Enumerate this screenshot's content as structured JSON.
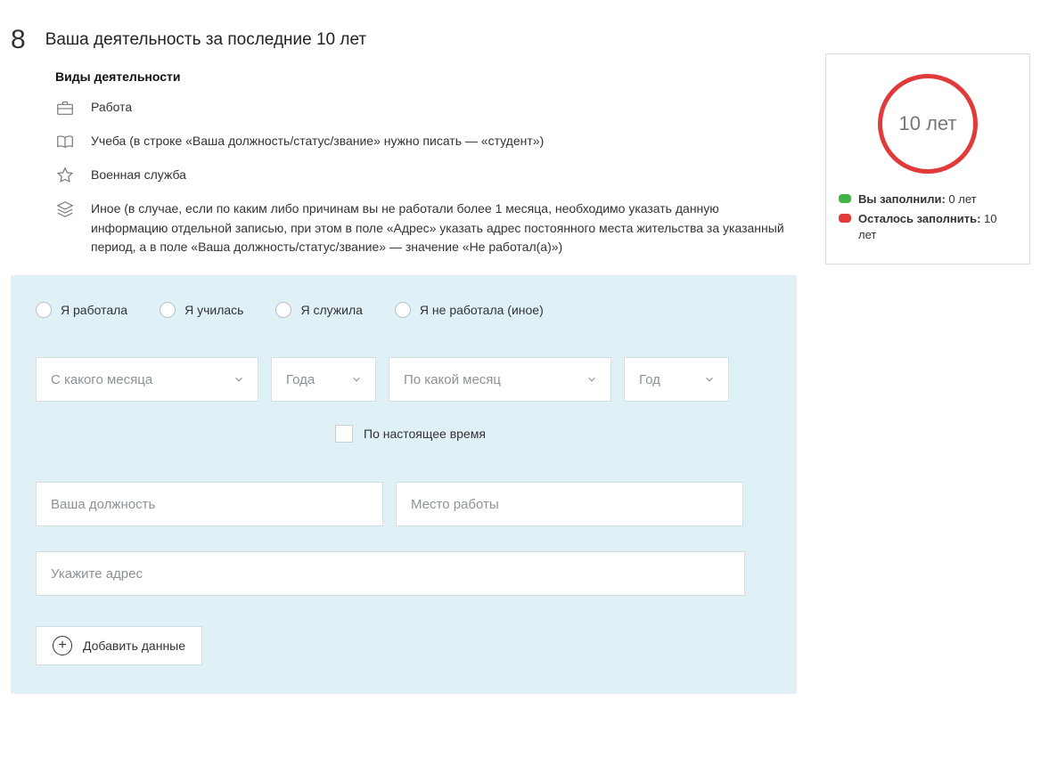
{
  "step_number": "8",
  "step_title": "Ваша деятельность за последние 10 лет",
  "subtitle": "Виды деятельности",
  "activities": [
    {
      "label": "Работа"
    },
    {
      "label": "Учеба (в строке «Ваша должность/статус/звание» нужно писать — «студент»)"
    },
    {
      "label": "Военная служба"
    },
    {
      "label": "Иное (в случае, если по каким либо причинам вы не работали более 1 месяца, необходимо указать данную информацию отдельной записью, при этом в поле «Адрес» указать адрес постоянного места жительства за указанный период, а в поле «Ваша должность/статус/звание» — значение «Не работал(а)»)"
    }
  ],
  "radios": {
    "work": "Я работала",
    "study": "Я училась",
    "service": "Я служила",
    "none": "Я не работала (иное)"
  },
  "selects": {
    "from_month": "С какого месяца",
    "from_year": "Года",
    "to_month": "По какой месяц",
    "to_year": "Год"
  },
  "checkbox_present": "По настоящее время",
  "inputs": {
    "position": "Ваша должность",
    "workplace": "Место работы",
    "address": "Укажите адрес"
  },
  "add_button": "Добавить данные",
  "info_card": {
    "circle_text": "10 лет",
    "filled_label": "Вы заполнили:",
    "filled_value": "0 лет",
    "remaining_label": "Осталось заполнить:",
    "remaining_value": "10 лет"
  }
}
